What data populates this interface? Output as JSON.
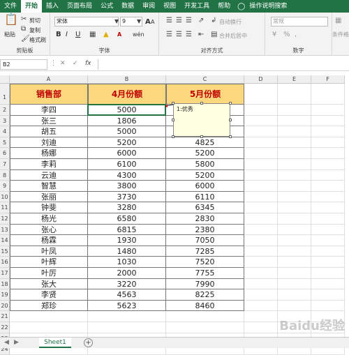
{
  "tabs": [
    "文件",
    "开始",
    "插入",
    "页面布局",
    "公式",
    "数据",
    "审阅",
    "视图",
    "开发工具",
    "帮助",
    "操作说明搜索"
  ],
  "clipboard": {
    "paste": "粘贴",
    "cut": "剪切",
    "copy": "复制",
    "format_painter": "格式刷",
    "label": "剪贴板"
  },
  "font": {
    "name": "宋体",
    "size": "9",
    "bold": "B",
    "italic": "I",
    "underline": "U",
    "label": "字体",
    "grow": "A",
    "wen": "wén"
  },
  "alignment": {
    "wrap": "自动换行",
    "merge": "合并后居中",
    "label": "对齐方式"
  },
  "number": {
    "format": "常规",
    "label": "数字",
    "cond_format": "条件格"
  },
  "formula_bar": {
    "name_box": "B2",
    "fx": "fx"
  },
  "columns": [
    "A",
    "B",
    "C",
    "D",
    "E",
    "F"
  ],
  "headers": [
    "销售部",
    "4月份额",
    "5月份额"
  ],
  "rows": [
    [
      "李四",
      "5000",
      ""
    ],
    [
      "张三",
      "1806",
      ""
    ],
    [
      "胡五",
      "5000",
      ""
    ],
    [
      "刘迪",
      "5200",
      "4825"
    ],
    [
      "杨娜",
      "6000",
      "5200"
    ],
    [
      "李莉",
      "6100",
      "5800"
    ],
    [
      "云迪",
      "4300",
      "5200"
    ],
    [
      "智慧",
      "3800",
      "6000"
    ],
    [
      "张丽",
      "3730",
      "6110"
    ],
    [
      "钟斐",
      "3280",
      "6345"
    ],
    [
      "杨光",
      "6580",
      "2830"
    ],
    [
      "张心",
      "6815",
      "2380"
    ],
    [
      "杨霖",
      "1930",
      "7050"
    ],
    [
      "叶凤",
      "1480",
      "7285"
    ],
    [
      "叶辉",
      "1030",
      "7520"
    ],
    [
      "叶厉",
      "2000",
      "7755"
    ],
    [
      "张大",
      "3220",
      "7990"
    ],
    [
      "李贤",
      "4563",
      "8225"
    ],
    [
      "郑珍",
      "5623",
      "8460"
    ]
  ],
  "row_numbers": [
    "1",
    "2",
    "3",
    "4",
    "5",
    "6",
    "7",
    "8",
    "9",
    "10",
    "11",
    "12",
    "13",
    "14",
    "15",
    "16",
    "17",
    "18",
    "19",
    "20",
    "21",
    "22",
    "23",
    "24"
  ],
  "comment": "1:优秀",
  "sheet_tab": "Sheet1",
  "watermark": "Baidu经验",
  "colors": {
    "accent": "#217346",
    "header_fill": "#fbd77e",
    "header_text": "#c00000"
  }
}
